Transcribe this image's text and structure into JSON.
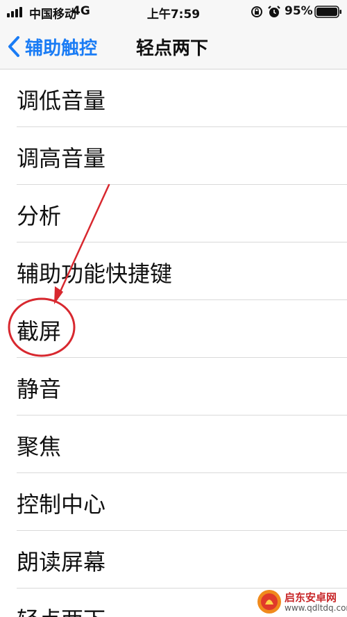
{
  "status_bar": {
    "carrier": "中国移动",
    "network": "4G",
    "time": "上午7:59",
    "battery": "95%",
    "icons": [
      "signal-icon",
      "orientation-lock-icon",
      "alarm-icon",
      "battery-icon"
    ]
  },
  "nav": {
    "back_label": "辅助触控",
    "title": "轻点两下",
    "accent_color": "#1a7cf5"
  },
  "list": {
    "items": [
      {
        "label": "调低音量"
      },
      {
        "label": "调高音量"
      },
      {
        "label": "分析"
      },
      {
        "label": "辅助功能快捷键"
      },
      {
        "label": "截屏"
      },
      {
        "label": "静音"
      },
      {
        "label": "聚焦"
      },
      {
        "label": "控制中心"
      },
      {
        "label": "朗读屏幕"
      },
      {
        "label": "轻点两下"
      }
    ]
  },
  "annotation": {
    "highlighted_item": "截屏",
    "color": "#d8282f",
    "shapes": [
      "arrow",
      "circle"
    ]
  },
  "watermark": {
    "name": "启东安卓网",
    "url": "www.qdltdq.com"
  }
}
